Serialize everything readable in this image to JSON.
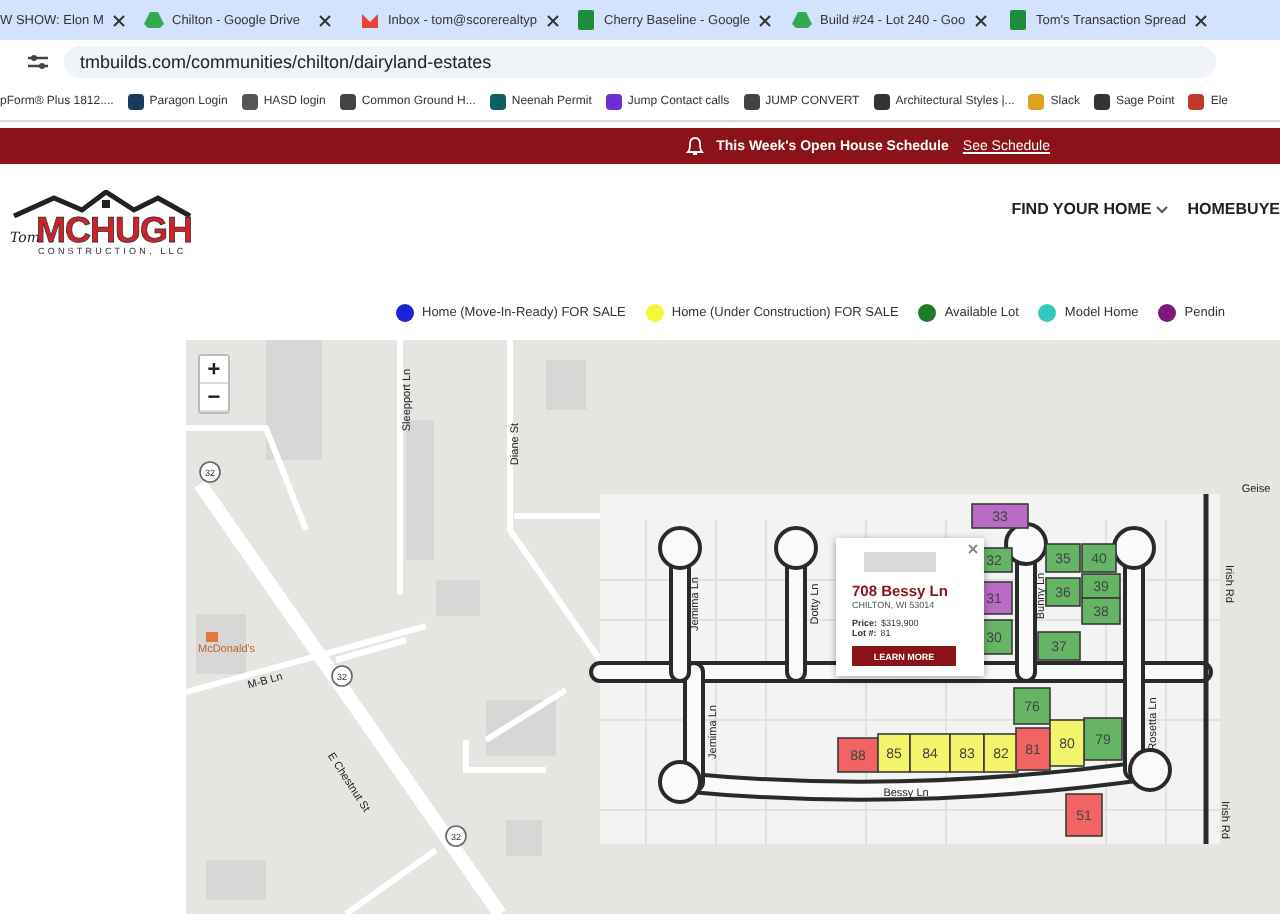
{
  "browser": {
    "tabs": [
      {
        "title": "W SHOW: Elon M"
      },
      {
        "title": "Chilton - Google Drive"
      },
      {
        "title": "Inbox - tom@scorerealtyp"
      },
      {
        "title": "Cherry Baseline - Google"
      },
      {
        "title": "Build #24 - Lot 240 - Goo"
      },
      {
        "title": "Tom's Transaction Spread"
      }
    ],
    "address": "tmbuilds.com/communities/chilton/dairyland-estates",
    "bookmarks": [
      "pForm® Plus 1812....",
      "Paragon Login",
      "HASD login",
      "Common Ground H...",
      "Neenah Permit",
      "Jump Contact calls",
      "JUMP CONVERT",
      "Architectural Styles |...",
      "Slack",
      "Sage Point",
      "Ele"
    ]
  },
  "banner": {
    "text": "This Week's Open House Schedule",
    "link": "See Schedule"
  },
  "header": {
    "logo": {
      "script": "Tom",
      "name": "MCHUGH",
      "sub": "CONSTRUCTION, LLC"
    },
    "nav": [
      "FIND YOUR HOME",
      "HOMEBUYE"
    ]
  },
  "legend": [
    {
      "label": "Home (Move-In-Ready) FOR SALE",
      "color": "#1c22d6"
    },
    {
      "label": "Home (Under Construction) FOR SALE",
      "color": "#f7f53a"
    },
    {
      "label": "Available Lot",
      "color": "#1e7a2a"
    },
    {
      "label": "Model Home",
      "color": "#33c9b8"
    },
    {
      "label": "Pendin",
      "color": "#7c1a7c"
    }
  ],
  "map": {
    "zoom_in": "+",
    "zoom_out": "−",
    "labels": [
      {
        "text": "Sleepport Ln",
        "kind": "street"
      },
      {
        "text": "Diane St",
        "kind": "street"
      },
      {
        "text": "M-B Ln",
        "kind": "street"
      },
      {
        "text": "E Chestnut St",
        "kind": "street"
      },
      {
        "text": "McDonald's",
        "kind": "place"
      },
      {
        "text": "32",
        "kind": "shield"
      },
      {
        "text": "32",
        "kind": "shield"
      },
      {
        "text": "32",
        "kind": "shield"
      },
      {
        "text": "Jemima Ln",
        "kind": "street"
      },
      {
        "text": "Dotty Ln",
        "kind": "street"
      },
      {
        "text": "Bunny Ln",
        "kind": "street"
      },
      {
        "text": "Rosetta Ln",
        "kind": "street"
      },
      {
        "text": "Jemima Ln",
        "kind": "street"
      },
      {
        "text": "Bessy Ln",
        "kind": "street"
      },
      {
        "text": "Irish Rd",
        "kind": "street"
      },
      {
        "text": "Irish Rd",
        "kind": "street"
      },
      {
        "text": "Geise",
        "kind": "street"
      }
    ],
    "lots": [
      {
        "number": "33",
        "color": "#b86cc4"
      },
      {
        "number": "32",
        "color": "#66b466"
      },
      {
        "number": "31",
        "color": "#b86cc4"
      },
      {
        "number": "30",
        "color": "#66b466"
      },
      {
        "number": "35",
        "color": "#66b466"
      },
      {
        "number": "40",
        "color": "#66b466"
      },
      {
        "number": "36",
        "color": "#66b466"
      },
      {
        "number": "39",
        "color": "#66b466"
      },
      {
        "number": "38",
        "color": "#66b466"
      },
      {
        "number": "37",
        "color": "#66b466"
      },
      {
        "number": "76",
        "color": "#66b466"
      },
      {
        "number": "79",
        "color": "#66b466"
      },
      {
        "number": "88",
        "color": "#f26464"
      },
      {
        "number": "85",
        "color": "#f4f46c"
      },
      {
        "number": "84",
        "color": "#f4f46c"
      },
      {
        "number": "83",
        "color": "#f4f46c"
      },
      {
        "number": "82",
        "color": "#f4f46c"
      },
      {
        "number": "81",
        "color": "#f26464"
      },
      {
        "number": "80",
        "color": "#f4f46c"
      },
      {
        "number": "51",
        "color": "#f26464"
      }
    ],
    "popup": {
      "title": "708 Bessy Ln",
      "city": "CHILTON, WI 53014",
      "price_label": "Price:",
      "price": "$319,900",
      "lot_label": "Lot #:",
      "lot": "81",
      "button": "LEARN MORE"
    }
  }
}
